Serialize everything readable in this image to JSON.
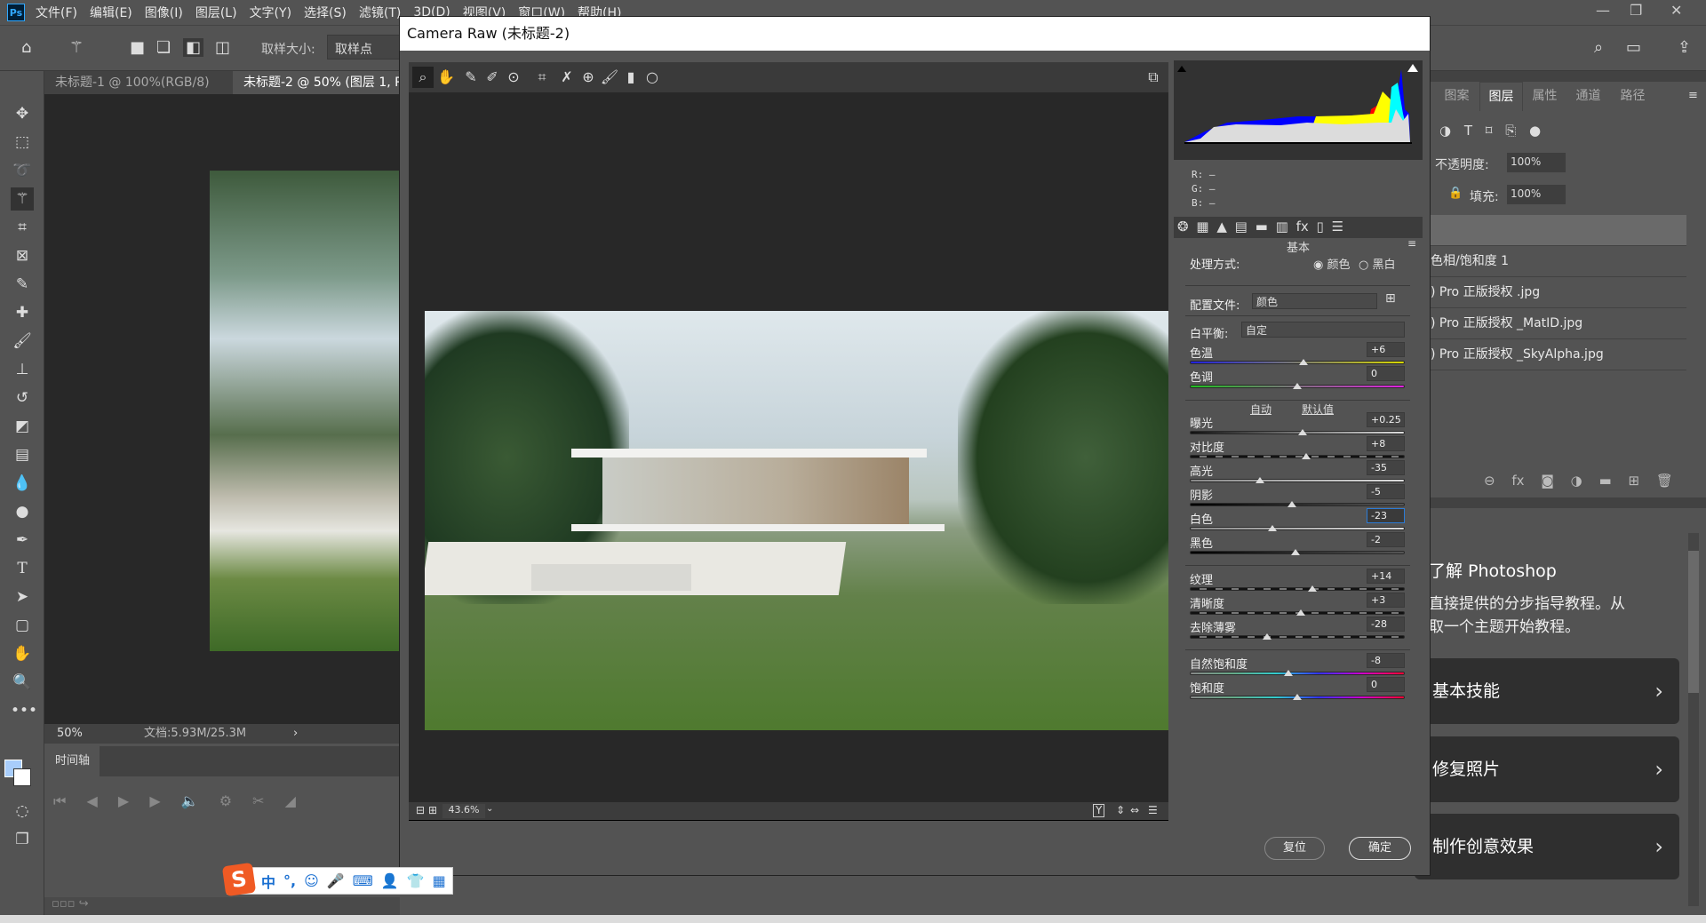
{
  "menubar": {
    "items": [
      "文件(F)",
      "编辑(E)",
      "图像(I)",
      "图层(L)",
      "文字(Y)",
      "选择(S)",
      "滤镜(T)",
      "3D(D)",
      "视图(V)",
      "窗口(W)",
      "帮助(H)"
    ]
  },
  "options": {
    "sample_size_label": "取样大小:",
    "sample_size_value": "取样点"
  },
  "doc_tabs": [
    "未标题-1 @ 100%(RGB/8)",
    "未标题-2 @ 50% (图层 1, R"
  ],
  "status": {
    "zoom": "50%",
    "doc": "文档:5.93M/25.3M"
  },
  "timeline": {
    "title": "时间轴"
  },
  "dialog": {
    "title": "Camera Raw (未标题-2)",
    "zoom_value": "43.6%",
    "rgb": {
      "r_label": "R:",
      "g_label": "G:",
      "b_label": "B:",
      "r": "—",
      "g": "—",
      "b": "—"
    },
    "section_title": "基本",
    "treatment_label": "处理方式:",
    "treatment_color": "颜色",
    "treatment_bw": "黑白",
    "treatment_selected": "颜色",
    "profile_label": "配置文件:",
    "profile_value": "颜色",
    "wb_label": "白平衡:",
    "wb_value": "自定",
    "auto_link": "自动",
    "default_link": "默认值",
    "sliders": [
      {
        "label": "色温",
        "value": "+6",
        "pos": 0.53,
        "track": "temp"
      },
      {
        "label": "色调",
        "value": "0",
        "pos": 0.5,
        "track": "tint"
      },
      {
        "label": "曝光",
        "value": "+0.25",
        "pos": 0.525,
        "track": "gray"
      },
      {
        "label": "对比度",
        "value": "+8",
        "pos": 0.54,
        "track": "dash"
      },
      {
        "label": "高光",
        "value": "-35",
        "pos": 0.325,
        "track": "light"
      },
      {
        "label": "阴影",
        "value": "-5",
        "pos": 0.475,
        "track": "dark"
      },
      {
        "label": "白色",
        "value": "-23",
        "pos": 0.385,
        "track": "light",
        "focused": true
      },
      {
        "label": "黑色",
        "value": "-2",
        "pos": 0.49,
        "track": "dark"
      },
      {
        "label": "纹理",
        "value": "+14",
        "pos": 0.57,
        "track": "dash"
      },
      {
        "label": "清晰度",
        "value": "+3",
        "pos": 0.515,
        "track": "dash"
      },
      {
        "label": "去除薄雾",
        "value": "-28",
        "pos": 0.36,
        "track": "dash"
      },
      {
        "label": "自然饱和度",
        "value": "-8",
        "pos": 0.46,
        "track": "rainbow"
      },
      {
        "label": "饱和度",
        "value": "0",
        "pos": 0.5,
        "track": "rainbow"
      }
    ],
    "reset_label": "复位",
    "ok_label": "确定"
  },
  "layers_panel": {
    "tabs": [
      "图案",
      "图层",
      "属性",
      "通道",
      "路径"
    ],
    "active_tab": "图层",
    "opacity_label": "不透明度:",
    "opacity_value": "100%",
    "fill_label": "填充:",
    "fill_value": "100%",
    "layers": [
      "色相/饱和度 1",
      ") Pro 正版授权 .jpg",
      ") Pro 正版授权 _MatID.jpg",
      ") Pro 正版授权 _SkyAlpha.jpg"
    ]
  },
  "learn": {
    "title": "了解 Photoshop",
    "desc1": "直接提供的分步指导教程。从",
    "desc2": "取一个主题开始教程。",
    "cards": [
      "基本技能",
      "修复照片",
      "制作创意效果"
    ]
  },
  "ime": {
    "mode": "中",
    "punct": "°,"
  }
}
